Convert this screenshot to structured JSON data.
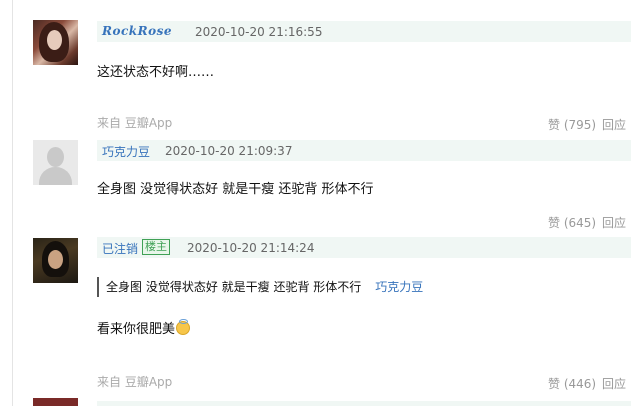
{
  "comments": [
    {
      "username": "RockRose",
      "timestamp": "2020-10-20 21:16:55",
      "text": "这还状态不好啊……",
      "source": "来自 豆瓣App",
      "like": "赞 (795)",
      "reply": "回应"
    },
    {
      "username": "巧克力豆",
      "timestamp": "2020-10-20 21:09:37",
      "text": "全身图 没觉得状态好 就是干瘦 还驼背 形体不行",
      "like": "赞 (645)",
      "reply": "回应"
    },
    {
      "username": "已注销",
      "badge": "楼主",
      "timestamp": "2020-10-20 21:14:24",
      "quote_text": "全身图 没觉得状态好 就是干瘦 还驼背 形体不行",
      "quote_author": "巧克力豆",
      "text": "看来你很肥美",
      "emoji": "innocent-smile",
      "source": "来自 豆瓣App",
      "like": "赞 (446)",
      "reply": "回应"
    }
  ],
  "colors": {
    "link": "#3773bb",
    "header_bg": "#f0f7f4",
    "badge_green": "#40a156",
    "meta_gray": "#999999"
  }
}
